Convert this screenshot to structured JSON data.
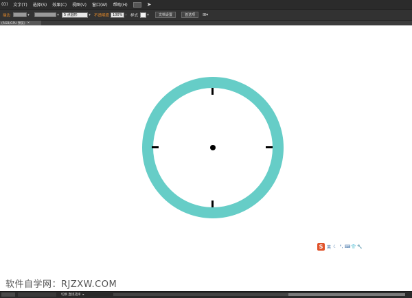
{
  "menubar": {
    "items": [
      "(O)",
      "文字(T)",
      "选择(S)",
      "效果(C)",
      "视图(V)",
      "窗口(W)",
      "帮助(H)"
    ],
    "icons": [
      "layout-switcher-icon",
      "send-icon"
    ]
  },
  "controlbar": {
    "stroke_label": "描边",
    "brush_value": "5 点圆形",
    "opacity_label": "不透明度",
    "opacity_value": "100%",
    "style_label": "样式",
    "doc_setup_button": "文档设置",
    "preferences_button": "首选项"
  },
  "tab": {
    "title": "(RGB/GPU 预览)",
    "close": "×"
  },
  "canvas": {
    "clock": {
      "ring_color": "#66cdc7",
      "tick_color": "#000000",
      "hand_count": 0,
      "ticks": [
        "12",
        "3",
        "6",
        "9"
      ]
    }
  },
  "tray": {
    "ime_badge": "S",
    "icons": [
      "english-mode-icon",
      "moon-icon",
      "punctuation-icon",
      "keyboard-icon",
      "shirt-icon",
      "wrench-icon"
    ]
  },
  "watermark": "软件自学网：RJZXW.COM",
  "statusbar": {
    "tool_text": "切换 直接选择"
  }
}
